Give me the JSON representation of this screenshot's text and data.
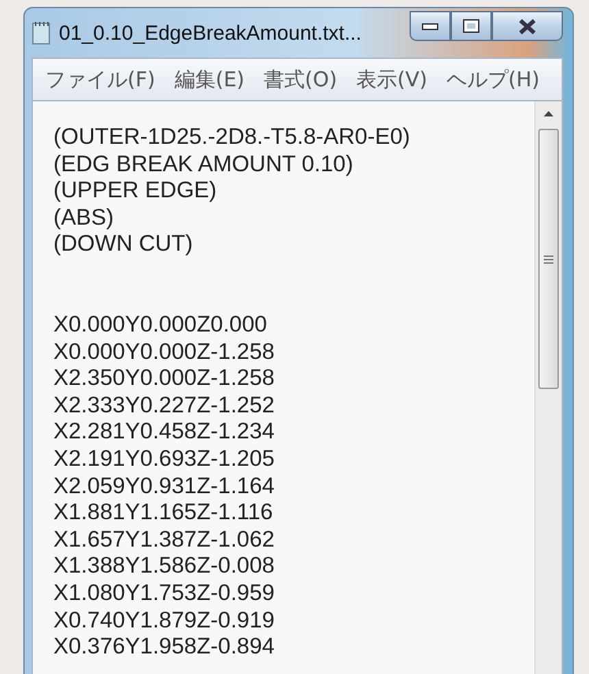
{
  "window": {
    "title": "01_0.10_EdgeBreakAmount.txt..."
  },
  "menu": [
    {
      "label": "ファイル(F)"
    },
    {
      "label": "編集(E)"
    },
    {
      "label": "書式(O)"
    },
    {
      "label": "表示(V)"
    },
    {
      "label": "ヘルプ(H)"
    }
  ],
  "document": {
    "header_lines": [
      "(OUTER-1D25.-2D8.-T5.8-AR0-E0)",
      "(EDG BREAK AMOUNT 0.10)",
      "(UPPER EDGE)",
      "(ABS)",
      "(DOWN CUT)"
    ],
    "coordinate_lines": [
      "X0.000Y0.000Z0.000",
      "X0.000Y0.000Z-1.258",
      "X2.350Y0.000Z-1.258",
      "X2.333Y0.227Z-1.252",
      "X2.281Y0.458Z-1.234",
      "X2.191Y0.693Z-1.205",
      "X2.059Y0.931Z-1.164",
      "X1.881Y1.165Z-1.116",
      "X1.657Y1.387Z-1.062",
      "X1.388Y1.586Z-0.008",
      "X1.080Y1.753Z-0.959",
      "X0.740Y1.879Z-0.919",
      "X0.376Y1.958Z-0.894"
    ]
  }
}
